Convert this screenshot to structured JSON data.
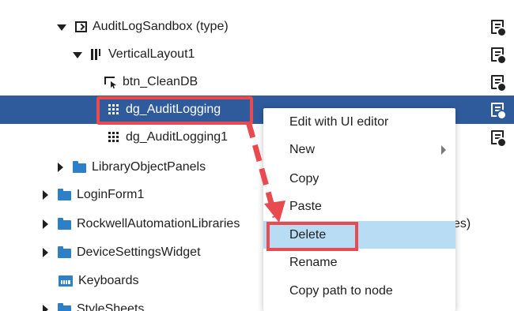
{
  "tree": {
    "rows": [
      {
        "label": "AuditLogSandbox (type)"
      },
      {
        "label": "VerticalLayout1"
      },
      {
        "label": "btn_CleanDB"
      },
      {
        "label": "dg_AuditLogging"
      },
      {
        "label": "dg_AuditLogging1"
      },
      {
        "label": "LibraryObjectPanels"
      },
      {
        "label": "LoginForm1"
      },
      {
        "label": "RockwellAutomationLibraries"
      },
      {
        "label": "DeviceSettingsWidget"
      },
      {
        "label": "Keyboards"
      },
      {
        "label": "StyleSheets"
      }
    ],
    "hidden_label_tail": "es)"
  },
  "context_menu": {
    "items": [
      {
        "label": "Edit with UI editor"
      },
      {
        "label": "New"
      },
      {
        "label": "Copy"
      },
      {
        "label": "Paste"
      },
      {
        "label": "Delete"
      },
      {
        "label": "Rename"
      },
      {
        "label": "Copy path to node"
      }
    ]
  },
  "colors": {
    "selection": "#2f5b9d",
    "menu_active": "#b7dcf4",
    "annotation": "#e84a4f",
    "folder": "#2d7fc7"
  },
  "icons": {
    "expanded": "chevron-down-icon",
    "collapsed": "chevron-right-icon",
    "type": "type-icon",
    "layout": "vertical-layout-icon",
    "button": "button-icon",
    "grid": "grid-icon",
    "folder": "folder-icon",
    "keyboard": "keyboard-icon",
    "properties": "document-gear-icon"
  }
}
